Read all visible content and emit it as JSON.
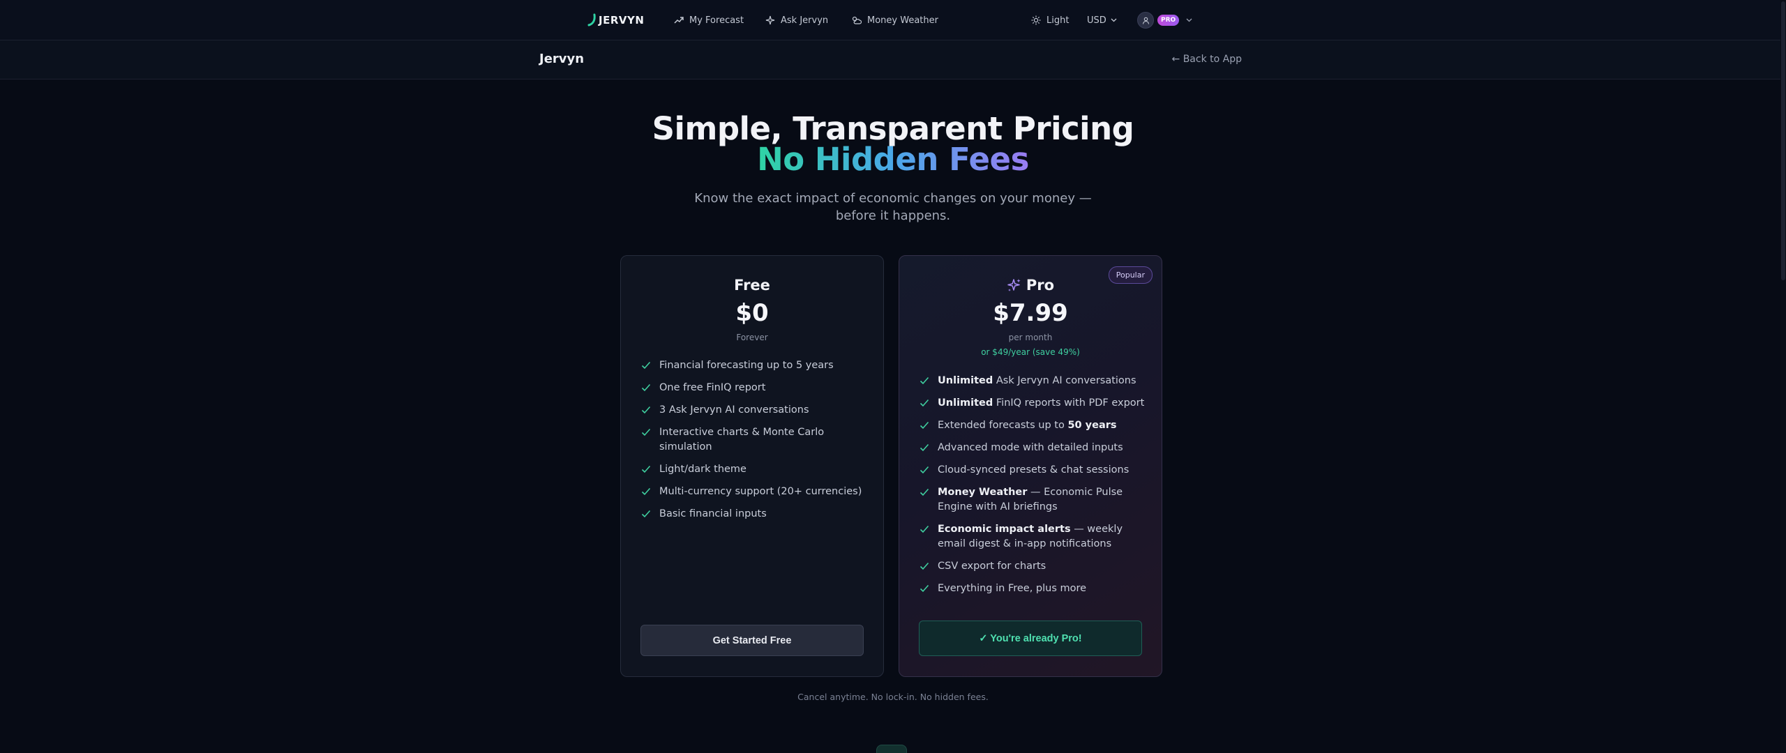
{
  "nav": {
    "logo_text": "JERVYN",
    "my_forecast": "My Forecast",
    "ask_jervyn": "Ask Jervyn",
    "money_weather": "Money Weather",
    "theme": "Light",
    "currency": "USD",
    "badge": "PRO"
  },
  "subheader": {
    "brand": "Jervyn",
    "back": "← Back to App"
  },
  "hero": {
    "title": "Simple, Transparent Pricing",
    "title_highlight": "No Hidden Fees",
    "subtitle": "Know the exact impact of economic changes on your money — before it happens."
  },
  "plans": {
    "free": {
      "name": "Free",
      "price": "$0",
      "period": "Forever",
      "features": [
        "Financial forecasting up to 5 years",
        "One free FinIQ report",
        "3 Ask Jervyn AI conversations",
        "Interactive charts & Monte Carlo simulation",
        "Light/dark theme",
        "Multi-currency support (20+ currencies)",
        "Basic financial inputs"
      ],
      "cta": "Get Started Free"
    },
    "pro": {
      "name": "Pro",
      "badge": "Popular",
      "price": "$7.99",
      "period": "per month",
      "annual": "or $49/year (save 49%)",
      "features": [
        {
          "bold": "Unlimited",
          "text": " Ask Jervyn AI conversations"
        },
        {
          "bold": "Unlimited",
          "text": " FinIQ reports with PDF export"
        },
        {
          "pre": "Extended forecasts up to ",
          "bold": "50 years"
        },
        {
          "text": "Advanced mode with detailed inputs"
        },
        {
          "text": "Cloud-synced presets & chat sessions"
        },
        {
          "bold": "Money Weather",
          "text": " — Economic Pulse Engine with AI briefings"
        },
        {
          "bold": "Economic impact alerts",
          "text": " — weekly email digest & in-app notifications"
        },
        {
          "text": "CSV export for charts"
        },
        {
          "text": "Everything in Free, plus more"
        }
      ],
      "cta": "✓ You're already Pro!"
    }
  },
  "footnote": "Cancel anytime. No lock-in. No hidden fees.",
  "colors": {
    "background": "#070b15",
    "accent_green": "#3fd0a0",
    "accent_purple": "#9a7cf2",
    "check": "#3fd0a0"
  },
  "icons": {
    "forecast": "trending-up-icon",
    "ask": "sparkles-icon",
    "weather": "cloud-sun-icon",
    "theme": "sun-icon",
    "user": "user-icon",
    "check": "check-icon"
  }
}
